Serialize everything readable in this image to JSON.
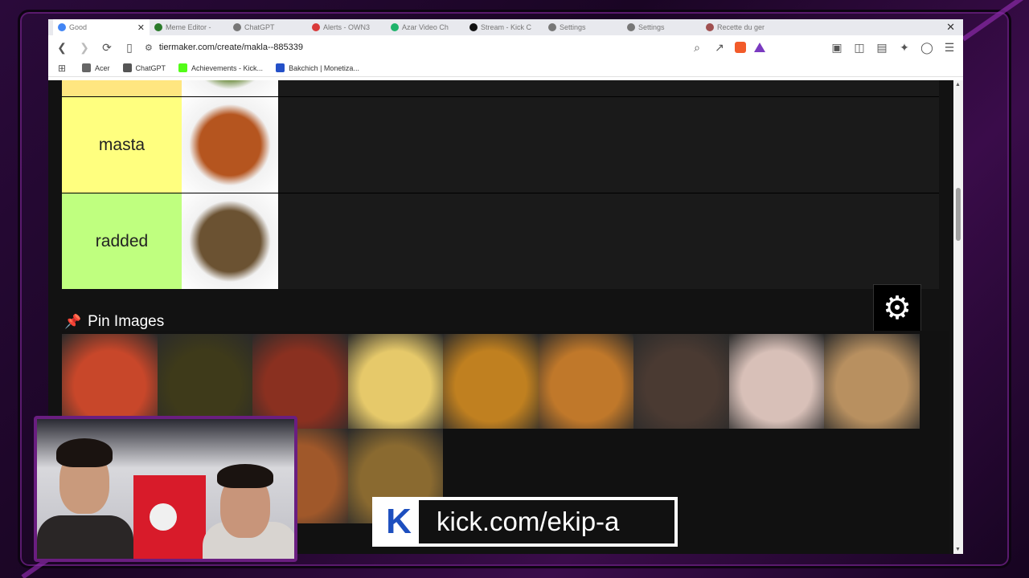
{
  "tabs": [
    {
      "label": "Good",
      "color": "#4285f4",
      "active": true
    },
    {
      "label": "Meme Editor -",
      "color": "#2a7a2a"
    },
    {
      "label": "ChatGPT",
      "color": "#777777"
    },
    {
      "label": "Alerts - OWN3",
      "color": "#d93a3a"
    },
    {
      "label": "Azar Video Ch",
      "color": "#1fb36b"
    },
    {
      "label": "Stream - Kick C",
      "color": "#111111"
    },
    {
      "label": "Settings",
      "color": "#777777"
    },
    {
      "label": "Settings",
      "color": "#777777"
    },
    {
      "label": "Recette du ger",
      "color": "#a05050"
    }
  ],
  "toolbar": {
    "url": "tiermaker.com/create/makla--885339"
  },
  "bookmarks": [
    {
      "label": "Acer",
      "color": "#666666"
    },
    {
      "label": "ChatGPT",
      "color": "#555555"
    },
    {
      "label": "Achievements - Kick...",
      "color": "#53fc18"
    },
    {
      "label": "Bakchich | Monetiza...",
      "color": "#2450c8"
    }
  ],
  "tiers": [
    {
      "label": "",
      "color": "#ffe680",
      "item_color": "#6a8a3a"
    },
    {
      "label": "masta",
      "color": "#ffff7f",
      "item_color": "#b5551f"
    },
    {
      "label": "radded",
      "color": "#bfff7f",
      "item_color": "#6b5232"
    }
  ],
  "pool": {
    "title": "Pin Images",
    "row1_colors": [
      "#c8472a",
      "#3e3a1a",
      "#8a3020",
      "#e6c96a",
      "#c08020",
      "#c0782a",
      "#4a3a32",
      "#d8c0b8",
      "#b89060"
    ],
    "row2_colors": [
      "#a0582a",
      "#8a6a30"
    ]
  },
  "kick": {
    "url_text": "kick.com/ekip-a"
  }
}
